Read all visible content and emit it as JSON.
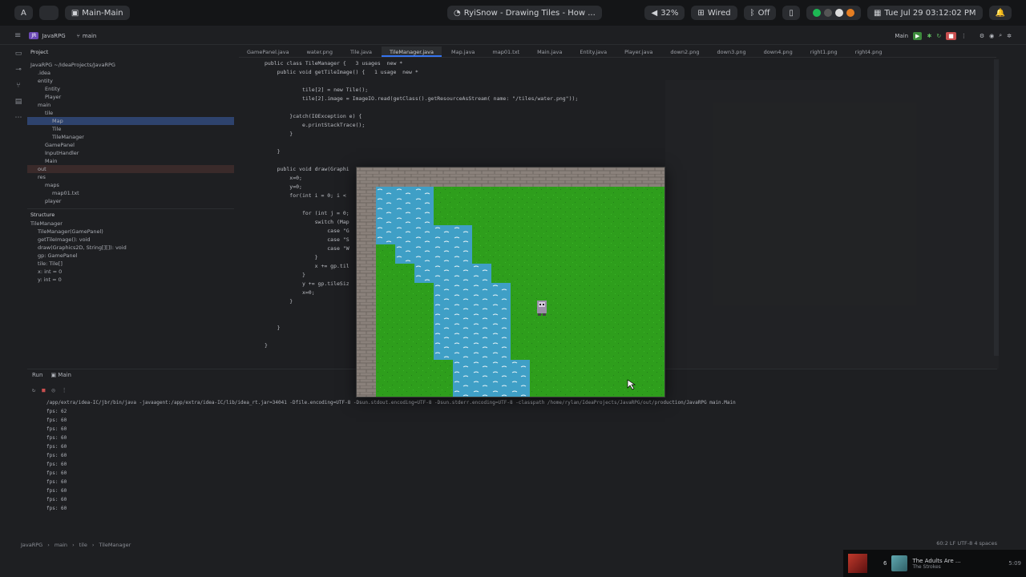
{
  "system_bar": {
    "activities_label": "A",
    "workspace_label": "",
    "window_title": "Main-Main",
    "now_playing": "RyiSnow - Drawing Tiles - How ...",
    "volume": "32%",
    "network": "Wired",
    "bluetooth": "Off",
    "datetime": "Tue Jul 29  03:12:02 PM"
  },
  "ide": {
    "project_name": "JavaRPG",
    "branch": "main",
    "run_config": "Main",
    "project_panel_title": "Project",
    "structure_panel_title": "Structure",
    "tree": [
      {
        "label": "JavaRPG  ~/IdeaProjects/JavaRPG",
        "depth": 0
      },
      {
        "label": ".idea",
        "depth": 1
      },
      {
        "label": "entity",
        "depth": 1
      },
      {
        "label": "Entity",
        "depth": 2
      },
      {
        "label": "Player",
        "depth": 2
      },
      {
        "label": "main",
        "depth": 1
      },
      {
        "label": "tile",
        "depth": 2
      },
      {
        "label": "Map",
        "depth": 3
      },
      {
        "label": "Tile",
        "depth": 3
      },
      {
        "label": "TileManager",
        "depth": 3
      },
      {
        "label": "GamePanel",
        "depth": 2
      },
      {
        "label": "InputHandler",
        "depth": 2
      },
      {
        "label": "Main",
        "depth": 2
      },
      {
        "label": "out",
        "depth": 1
      },
      {
        "label": "res",
        "depth": 1
      },
      {
        "label": "maps",
        "depth": 2
      },
      {
        "label": "map01.txt",
        "depth": 3
      },
      {
        "label": "player",
        "depth": 2
      }
    ],
    "structure": [
      {
        "label": "TileManager",
        "depth": 0
      },
      {
        "label": "TileManager(GamePanel)",
        "depth": 1
      },
      {
        "label": "getTileImage(): void",
        "depth": 1
      },
      {
        "label": "draw(Graphics2D, String[][]): void",
        "depth": 1
      },
      {
        "label": "gp: GamePanel",
        "depth": 1
      },
      {
        "label": "tile: Tile[]",
        "depth": 1
      },
      {
        "label": "x: int = 0",
        "depth": 1
      },
      {
        "label": "y: int = 0",
        "depth": 1
      }
    ],
    "tabs": [
      "GamePanel.java",
      "water.png",
      "Tile.java",
      "TileManager.java",
      "Map.java",
      "map01.txt",
      "Main.java",
      "Entity.java",
      "Player.java",
      "down2.png",
      "down3.png",
      "down4.png",
      "right1.png",
      "right4.png"
    ],
    "active_tab": "TileManager.java",
    "code_lines": [
      {
        "n": "",
        "text": "public class TileManager {   3 usages  new *",
        "indent": 0
      },
      {
        "n": "",
        "text": "    public void getTileImage() {   1 usage  new *",
        "indent": 0
      },
      {
        "n": "",
        "text": "",
        "indent": 0
      },
      {
        "n": "",
        "text": "            tile[2] = new Tile();",
        "indent": 0
      },
      {
        "n": "",
        "text": "            tile[2].image = ImageIO.read(getClass().getResourceAsStream( name: \"/tiles/water.png\"));",
        "indent": 0
      },
      {
        "n": "",
        "text": "",
        "indent": 0
      },
      {
        "n": "",
        "text": "        }catch(IOException e) {",
        "indent": 0
      },
      {
        "n": "",
        "text": "            e.printStackTrace();",
        "indent": 0
      },
      {
        "n": "",
        "text": "        }",
        "indent": 0
      },
      {
        "n": "",
        "text": "",
        "indent": 0
      },
      {
        "n": "",
        "text": "    }",
        "indent": 0
      },
      {
        "n": "",
        "text": "",
        "indent": 0
      },
      {
        "n": "",
        "text": "    public void draw(Graphi",
        "indent": 0
      },
      {
        "n": "",
        "text": "        x=0;",
        "indent": 0
      },
      {
        "n": "",
        "text": "        y=0;",
        "indent": 0
      },
      {
        "n": "",
        "text": "        for(int i = 0; i <",
        "indent": 0
      },
      {
        "n": "",
        "text": "",
        "indent": 0
      },
      {
        "n": "",
        "text": "            for (int j = 0;",
        "indent": 0
      },
      {
        "n": "",
        "text": "                switch (Map",
        "indent": 0
      },
      {
        "n": "",
        "text": "                    case \"G",
        "indent": 0
      },
      {
        "n": "",
        "text": "                    case \"S",
        "indent": 0
      },
      {
        "n": "",
        "text": "                    case \"W",
        "indent": 0
      },
      {
        "n": "",
        "text": "                }",
        "indent": 0
      },
      {
        "n": "",
        "text": "                x += gp.til",
        "indent": 0
      },
      {
        "n": "",
        "text": "            }",
        "indent": 0
      },
      {
        "n": "",
        "text": "            y += gp.tileSiz",
        "indent": 0
      },
      {
        "n": "",
        "text": "            x=0;",
        "indent": 0
      },
      {
        "n": "",
        "text": "        }",
        "indent": 0
      },
      {
        "n": "",
        "text": "",
        "indent": 0
      },
      {
        "n": "",
        "text": "",
        "indent": 0
      },
      {
        "n": "",
        "text": "    }",
        "indent": 0
      },
      {
        "n": "",
        "text": "",
        "indent": 0
      },
      {
        "n": "",
        "text": "}",
        "indent": 0
      }
    ],
    "run_tab": "Run",
    "run_config_tab": "Main",
    "command": "/app/extra/idea-IC/jbr/bin/java -javaagent:/app/extra/idea-IC/lib/idea_rt.jar=34041 -Dfile.encoding=UTF-8 -Dsun.stdout.encoding=UTF-8 -Dsun.stderr.encoding=UTF-8 -classpath /home/rylan/IdeaProjects/JavaRPG/out/production/JavaRPG main.Main",
    "console": [
      "fps: 62",
      "fps: 60",
      "fps: 60",
      "fps: 60",
      "fps: 60",
      "fps: 60",
      "fps: 60",
      "fps: 60",
      "fps: 60",
      "fps: 60",
      "fps: 60",
      "fps: 60"
    ],
    "breadcrumb": [
      "JavaRPG",
      "main",
      "tile",
      "TileManager"
    ],
    "status_right": "60:2   LF   UTF-8   4 spaces"
  },
  "game": {
    "colors": {
      "grass": "#2e9e1c",
      "grass_dark": "#24801a",
      "water": "#3f9fc6",
      "water_wave": "#e8f4f8",
      "wall": "#8a817b",
      "wall_line": "#6e6661"
    }
  },
  "media": {
    "track_title": "The Adults Are ...",
    "artist": "The Strokes",
    "time": "5:09",
    "queue_count": "6"
  }
}
